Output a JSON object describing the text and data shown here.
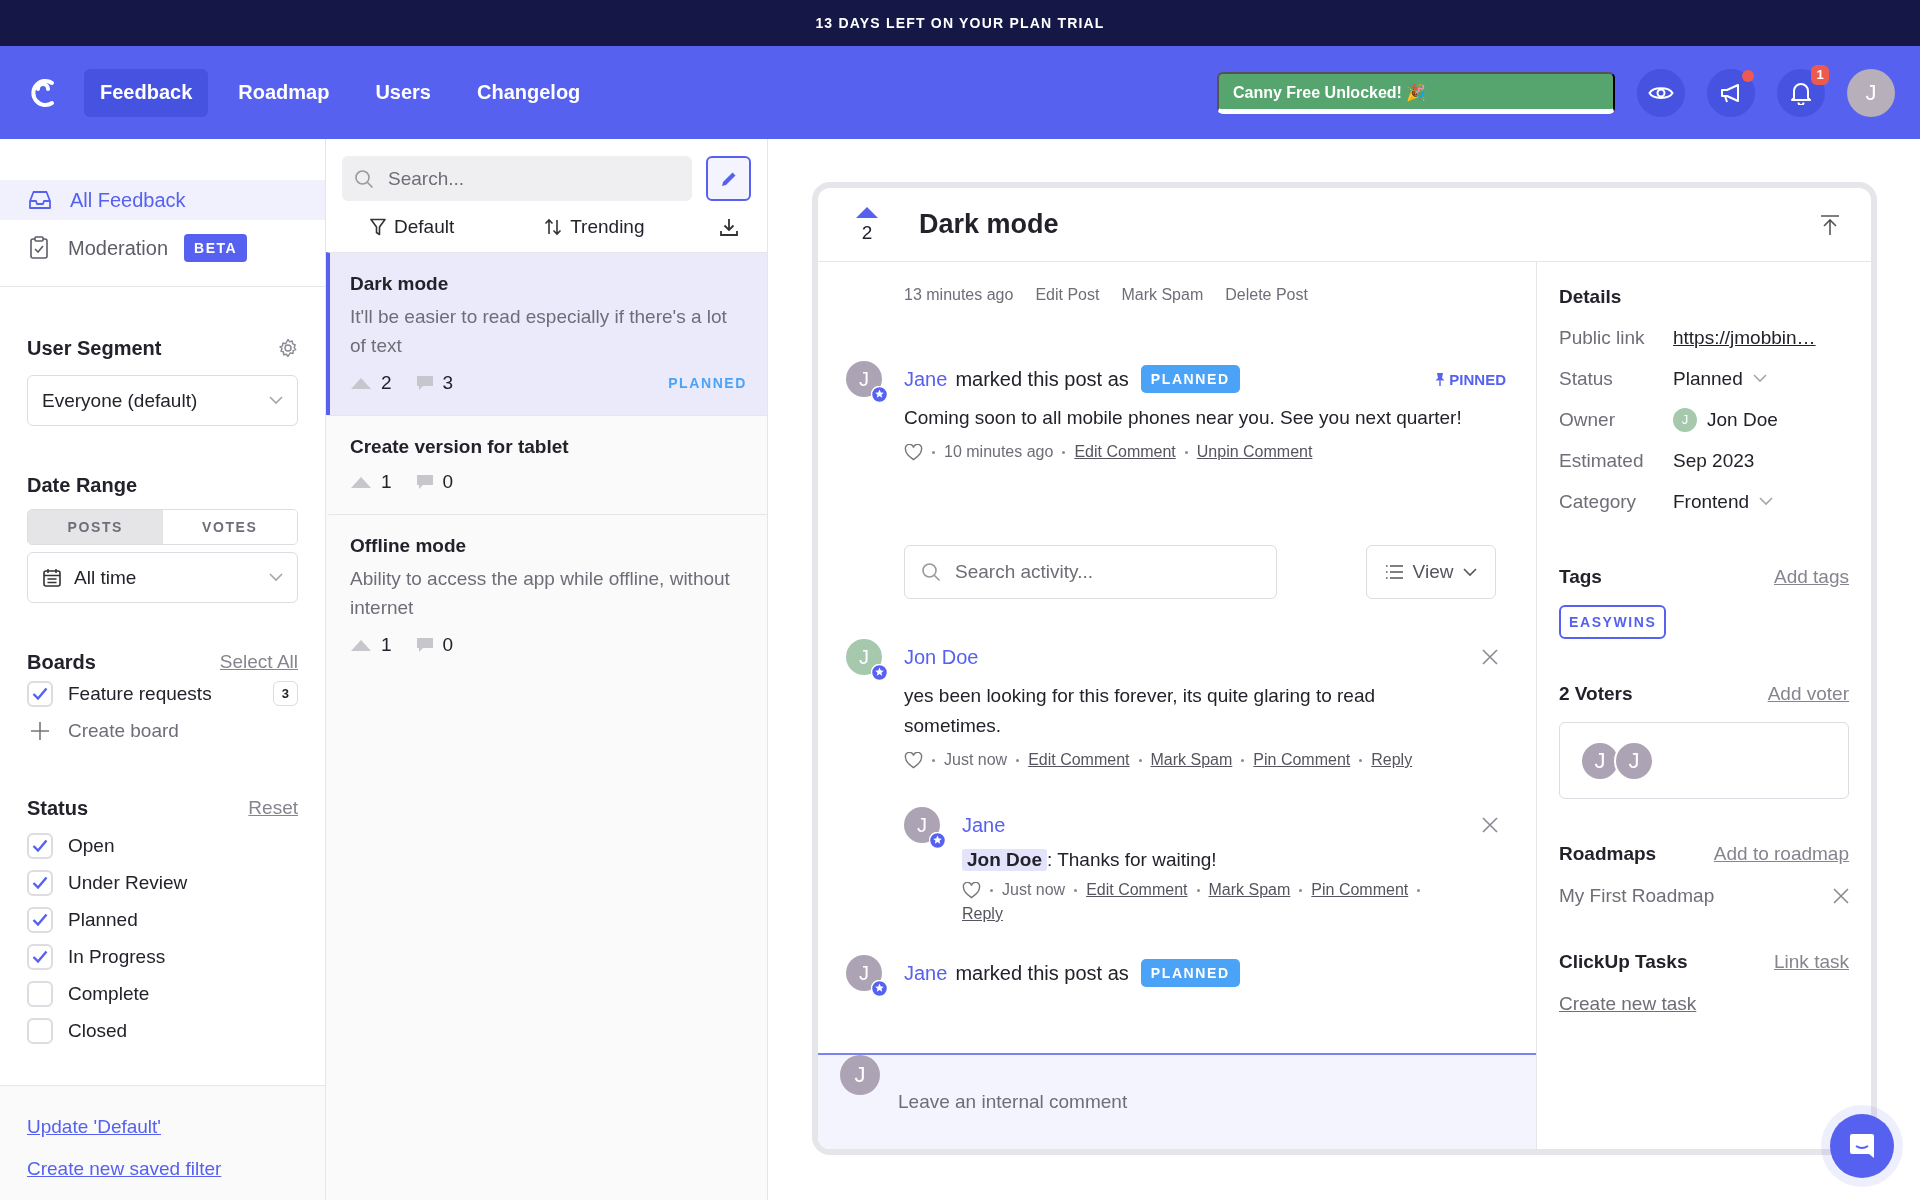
{
  "banner": {
    "text": "13 DAYS LEFT ON YOUR PLAN TRIAL"
  },
  "nav": {
    "items": [
      {
        "label": "Feedback",
        "selected": true
      },
      {
        "label": "Roadmap",
        "selected": false
      },
      {
        "label": "Users",
        "selected": false
      },
      {
        "label": "Changelog",
        "selected": false
      }
    ],
    "promo": "Canny Free Unlocked! 🎉",
    "notifications": "1",
    "avatar": "J"
  },
  "sidebar": {
    "views": [
      {
        "label": "All Feedback",
        "selected": true,
        "kind": "inbox"
      },
      {
        "label": "Moderation",
        "selected": false,
        "kind": "moderation",
        "badge": "BETA"
      }
    ],
    "user_segment": {
      "title": "User Segment",
      "value": "Everyone (default)"
    },
    "date_range": {
      "title": "Date Range",
      "modes": [
        {
          "label": "POSTS",
          "selected": true
        },
        {
          "label": "VOTES",
          "selected": false
        }
      ],
      "value": "All time"
    },
    "boards": {
      "title": "Boards",
      "action": "Select All",
      "items": [
        {
          "label": "Feature requests",
          "checked": true,
          "count": "3"
        }
      ],
      "create": "Create board"
    },
    "status": {
      "title": "Status",
      "action": "Reset",
      "items": [
        {
          "label": "Open",
          "checked": true
        },
        {
          "label": "Under Review",
          "checked": true
        },
        {
          "label": "Planned",
          "checked": true
        },
        {
          "label": "In Progress",
          "checked": true
        },
        {
          "label": "Complete",
          "checked": false
        },
        {
          "label": "Closed",
          "checked": false
        }
      ]
    },
    "footer_links": [
      "Update 'Default'",
      "Create new saved filter"
    ]
  },
  "post_list": {
    "search_placeholder": "Search...",
    "filter": "Default",
    "sort": "Trending",
    "posts": [
      {
        "title": "Dark mode",
        "description": "It'll be easier to read especially if there's a lot of text",
        "votes": "2",
        "comments": "3",
        "status": "PLANNED",
        "selected": true
      },
      {
        "title": "Create version for tablet",
        "votes": "1",
        "comments": "0",
        "selected": false
      },
      {
        "title": "Offline mode",
        "description": "Ability to access the app while offline, without internet",
        "votes": "1",
        "comments": "0",
        "selected": false
      }
    ]
  },
  "post": {
    "votes": "2",
    "title": "Dark mode",
    "meta": [
      "13 minutes ago",
      "Edit Post",
      "Mark Spam",
      "Delete Post"
    ],
    "pinned": {
      "author": "Jane",
      "avatar": "J",
      "color": "#aca4b4",
      "action": "marked this post as",
      "status": "PLANNED",
      "pin": "PINNED",
      "text": "Coming soon to all mobile phones near you. See you next quarter!",
      "time": "10 minutes ago",
      "actions": [
        "Edit Comment",
        "Unpin Comment"
      ]
    },
    "search_placeholder": "Search activity...",
    "view": "View",
    "entries": [
      {
        "kind": "comment",
        "author": "Jon Doe",
        "avatar": "J",
        "color": "#a6c9ae",
        "text": "yes been looking for this forever, its quite glaring to read sometimes.",
        "time": "Just now",
        "actions": [
          "Edit Comment",
          "Mark Spam",
          "Pin Comment",
          "Reply"
        ],
        "replies": [
          {
            "author": "Jane",
            "avatar": "J",
            "color": "#aca4b4",
            "mention": "Jon Doe",
            "text": ": Thanks for waiting!",
            "time": "Just now",
            "actions": [
              "Edit Comment",
              "Mark Spam",
              "Pin Comment",
              "Reply"
            ]
          }
        ]
      },
      {
        "kind": "status_change",
        "author": "Jane",
        "avatar": "J",
        "color": "#aca4b4",
        "action": "marked this post as",
        "status": "PLANNED"
      }
    ],
    "composer": {
      "avatar": "J",
      "placeholder": "Leave an internal comment"
    }
  },
  "details": {
    "title": "Details",
    "rows": [
      {
        "label": "Public link",
        "value": "https://jmobbin…",
        "kind": "link"
      },
      {
        "label": "Status",
        "value": "Planned",
        "kind": "dropdown"
      },
      {
        "label": "Owner",
        "value": "Jon Doe",
        "kind": "person",
        "avatar": "J",
        "color": "#a6c9ae"
      },
      {
        "label": "Estimated",
        "value": "Sep 2023",
        "kind": "text"
      },
      {
        "label": "Category",
        "value": "Frontend",
        "kind": "dropdown"
      }
    ],
    "tags": {
      "title": "Tags",
      "action": "Add tags",
      "items": [
        "EASYWINS"
      ]
    },
    "voters": {
      "title": "2 Voters",
      "action": "Add voter",
      "avatars": [
        {
          "letter": "J",
          "color": "#aca4b4"
        },
        {
          "letter": "J",
          "color": "#aca4b4"
        }
      ]
    },
    "roadmaps": {
      "title": "Roadmaps",
      "action": "Add to roadmap",
      "items": [
        "My First Roadmap"
      ]
    },
    "tasks": {
      "title": "ClickUp Tasks",
      "action": "Link task",
      "link": "Create new task"
    }
  }
}
